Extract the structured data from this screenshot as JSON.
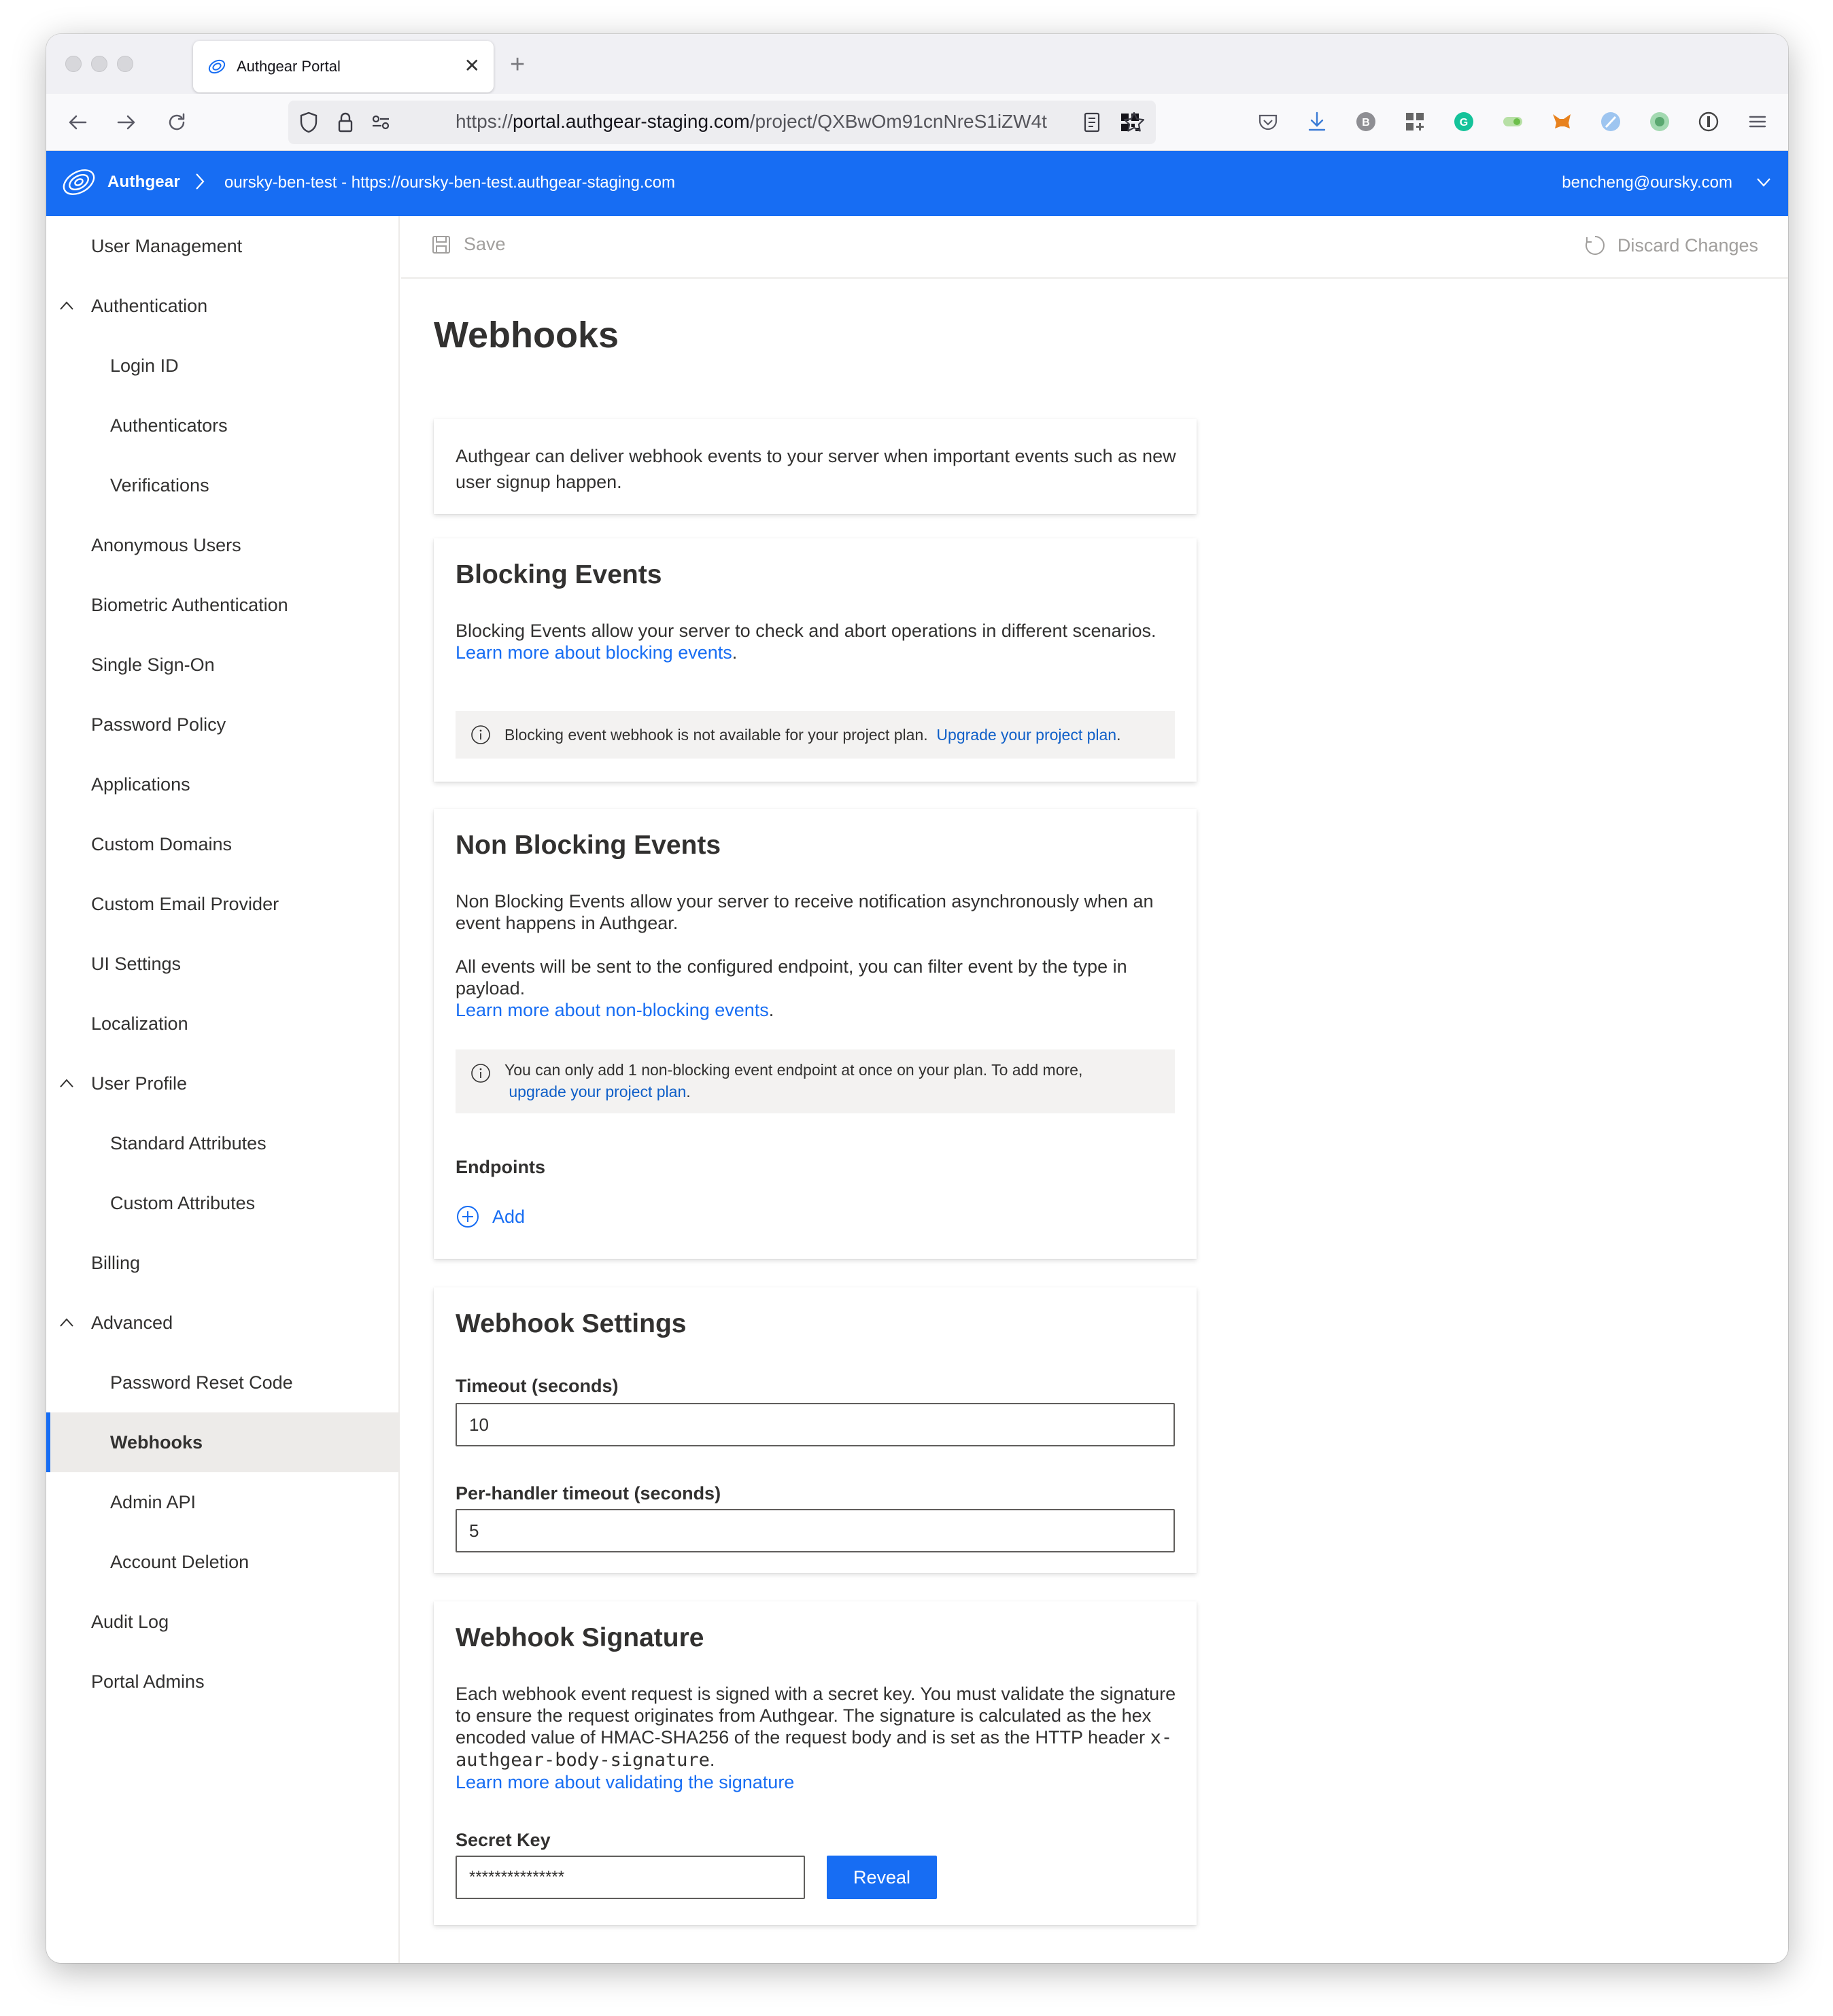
{
  "browser": {
    "tab_title": "Authgear Portal",
    "url_scheme": "https://",
    "url_host": "portal.authgear-staging.com",
    "url_path": "/project/QXBwOm91cnNreS1iZW4t"
  },
  "appbar": {
    "brand": "Authgear",
    "project": "oursky-ben-test - https://oursky-ben-test.authgear-staging.com",
    "user_email": "bencheng@oursky.com"
  },
  "sidebar": {
    "items": [
      {
        "label": "User Management"
      },
      {
        "label": "Authentication"
      },
      {
        "label": "Login ID"
      },
      {
        "label": "Authenticators"
      },
      {
        "label": "Verifications"
      },
      {
        "label": "Anonymous Users"
      },
      {
        "label": "Biometric Authentication"
      },
      {
        "label": "Single Sign-On"
      },
      {
        "label": "Password Policy"
      },
      {
        "label": "Applications"
      },
      {
        "label": "Custom Domains"
      },
      {
        "label": "Custom Email Provider"
      },
      {
        "label": "UI Settings"
      },
      {
        "label": "Localization"
      },
      {
        "label": "User Profile"
      },
      {
        "label": "Standard Attributes"
      },
      {
        "label": "Custom Attributes"
      },
      {
        "label": "Billing"
      },
      {
        "label": "Advanced"
      },
      {
        "label": "Password Reset Code"
      },
      {
        "label": "Webhooks"
      },
      {
        "label": "Admin API"
      },
      {
        "label": "Account Deletion"
      },
      {
        "label": "Audit Log"
      },
      {
        "label": "Portal Admins"
      }
    ]
  },
  "commandbar": {
    "save_label": "Save",
    "discard_label": "Discard Changes"
  },
  "page": {
    "title": "Webhooks",
    "intro": "Authgear can deliver webhook events to your server when important events such as new user signup happen.",
    "blocking": {
      "title": "Blocking Events",
      "desc": "Blocking Events allow your server to check and abort operations in different scenarios.",
      "link": "Learn more about blocking events",
      "notice": "Blocking event webhook is not available for your project plan.",
      "notice_link": "Upgrade your project plan"
    },
    "non_blocking": {
      "title": "Non Blocking Events",
      "desc1": "Non Blocking Events allow your server to receive notification asynchronously when an event happens in Authgear.",
      "desc2": "All events will be sent to the configured endpoint, you can filter event by the type in payload.",
      "link": "Learn more about non-blocking events",
      "notice": "You can only add 1 non-blocking event endpoint at once on your plan. To add more,",
      "notice_link": "upgrade your project plan",
      "endpoints_label": "Endpoints",
      "add_label": "Add"
    },
    "settings": {
      "title": "Webhook Settings",
      "timeout_label": "Timeout (seconds)",
      "timeout_value": "10",
      "per_handler_label": "Per-handler timeout (seconds)",
      "per_handler_value": "5"
    },
    "signature": {
      "title": "Webhook Signature",
      "desc": "Each webhook event request is signed with a secret key. You must validate the signature to ensure the request originates from Authgear. The signature is calculated as the hex encoded value of HMAC-SHA256 of the request body and is set as the HTTP header",
      "header_name": "x-authgear-body-signature",
      "link": "Learn more about validating the signature",
      "secret_label": "Secret Key",
      "secret_value": "***************",
      "reveal_label": "Reveal"
    }
  },
  "colors": {
    "accent": "#176df3",
    "text": "#323130",
    "notice_bg": "#f3f2f1"
  }
}
